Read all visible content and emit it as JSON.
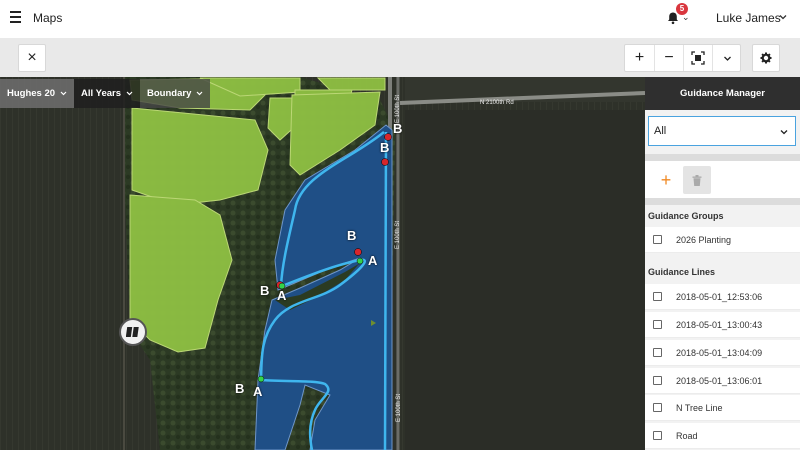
{
  "header": {
    "title": "Maps",
    "notification_count": "5",
    "user_name": "Luke James"
  },
  "toolbar": {
    "close": "×",
    "zoom_in": "+",
    "zoom_out": "−"
  },
  "map": {
    "filters": [
      {
        "label": "Hughes 20"
      },
      {
        "label": "All Years"
      },
      {
        "label": "Boundary"
      }
    ],
    "road_labels": {
      "north_road": "N 2100th Rd",
      "east_road_upper": "E 100th St",
      "east_road_mid": "E 100th St",
      "east_road_lower": "E 100th St"
    },
    "guidance_markers": {
      "b_top_right_1": "B",
      "b_top_right_2": "B",
      "b_mid": "B",
      "a_mid": "A",
      "b_left": "B",
      "a_left": "A",
      "b_bottom": "B",
      "a_bottom": "A"
    },
    "colors": {
      "field_green": "#8fc043",
      "water_blue": "#1f4f86",
      "guidance_line": "#3fb6ee",
      "point_a": "#35d24a",
      "point_b": "#d8262b"
    }
  },
  "panel": {
    "title": "Guidance Manager",
    "filter_value": "All",
    "groups_title": "Guidance Groups",
    "groups": [
      {
        "label": "2026 Planting"
      }
    ],
    "lines_title": "Guidance Lines",
    "lines": [
      {
        "label": "2018-05-01_12:53:06"
      },
      {
        "label": "2018-05-01_13:00:43"
      },
      {
        "label": "2018-05-01_13:04:09"
      },
      {
        "label": "2018-05-01_13:06:01"
      },
      {
        "label": "N Tree Line"
      },
      {
        "label": "Road"
      }
    ]
  }
}
